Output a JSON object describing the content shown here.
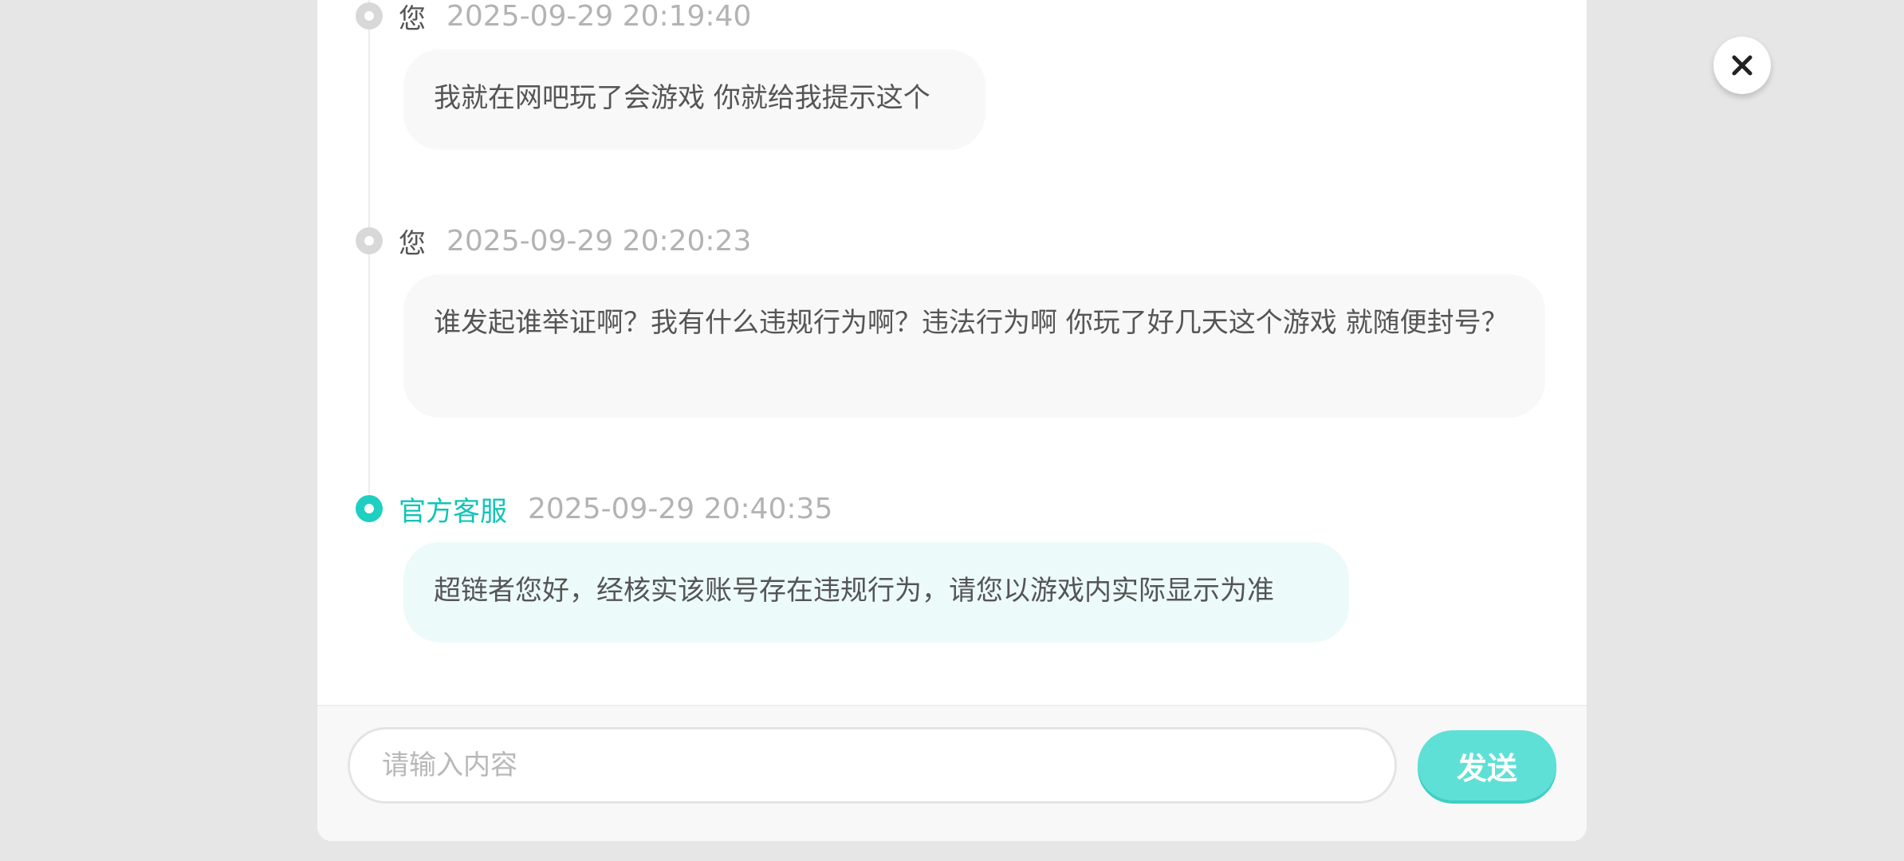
{
  "messages": [
    {
      "sender": "您",
      "timestamp": "2025-09-29 20:19:40",
      "text": "我就在网吧玩了会游戏 你就给我提示这个",
      "role": "user"
    },
    {
      "sender": "您",
      "timestamp": "2025-09-29 20:20:23",
      "text": "谁发起谁举证啊？我有什么违规行为啊？违法行为啊 你玩了好几天这个游戏 就随便封号？",
      "role": "user"
    },
    {
      "sender": "官方客服",
      "timestamp": "2025-09-29 20:40:35",
      "text": "超链者您好，经核实该账号存在违规行为，请您以游戏内实际显示为准",
      "role": "official"
    }
  ],
  "composer": {
    "placeholder": "请输入内容",
    "value": "",
    "send_label": "发送"
  },
  "icons": {
    "close": "close-icon",
    "user_dot": "timeline-dot-icon",
    "official_dot": "timeline-dot-active-icon"
  },
  "colors": {
    "accent": "#1fcfc1",
    "send_button": "#5fe0d6",
    "official_bubble": "#ecfbfa",
    "user_bubble": "#f8f8f8"
  }
}
